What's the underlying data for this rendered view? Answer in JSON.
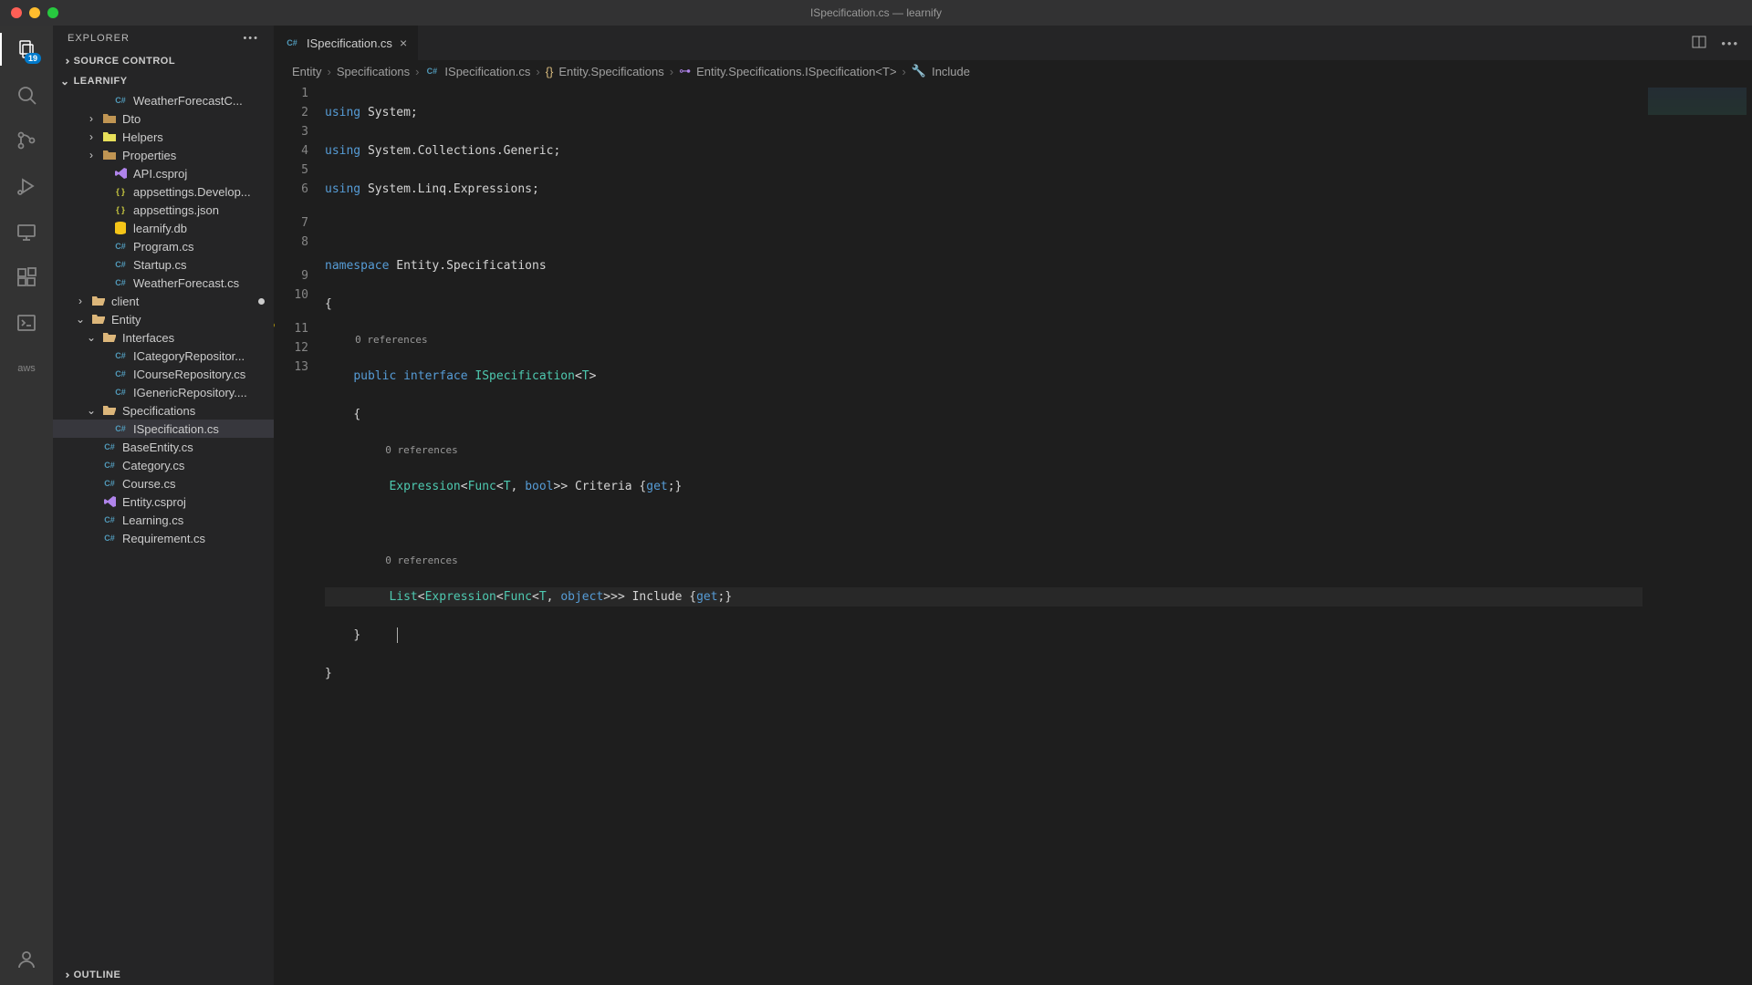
{
  "window": {
    "title": "ISpecification.cs — learnify"
  },
  "activityBar": {
    "badge": "19"
  },
  "sidebar": {
    "title": "EXPLORER",
    "sections": {
      "sourceControl": "SOURCE CONTROL",
      "project": "LEARNIFY",
      "outline": "OUTLINE"
    },
    "items": [
      {
        "label": "WeatherForecastC...",
        "icon": "cs",
        "indent": 4
      },
      {
        "label": "Dto",
        "icon": "folder",
        "twist": ">",
        "indent": 3
      },
      {
        "label": "Helpers",
        "icon": "folder-y",
        "twist": ">",
        "indent": 3
      },
      {
        "label": "Properties",
        "icon": "folder",
        "twist": ">",
        "indent": 3
      },
      {
        "label": "API.csproj",
        "icon": "vs",
        "indent": 4
      },
      {
        "label": "appsettings.Develop...",
        "icon": "json",
        "indent": 4
      },
      {
        "label": "appsettings.json",
        "icon": "json",
        "indent": 4
      },
      {
        "label": "learnify.db",
        "icon": "db",
        "indent": 4
      },
      {
        "label": "Program.cs",
        "icon": "cs",
        "indent": 4
      },
      {
        "label": "Startup.cs",
        "icon": "cs",
        "indent": 4
      },
      {
        "label": "WeatherForecast.cs",
        "icon": "cs",
        "indent": 4
      },
      {
        "label": "client",
        "icon": "folder-open",
        "twist": ">",
        "indent": 2,
        "dirty": true
      },
      {
        "label": "Entity",
        "icon": "folder-open",
        "twist": "v",
        "indent": 2
      },
      {
        "label": "Interfaces",
        "icon": "folder-open",
        "twist": "v",
        "indent": 3
      },
      {
        "label": "ICategoryRepositor...",
        "icon": "cs",
        "indent": 4
      },
      {
        "label": "ICourseRepository.cs",
        "icon": "cs",
        "indent": 4
      },
      {
        "label": "IGenericRepository....",
        "icon": "cs",
        "indent": 4
      },
      {
        "label": "Specifications",
        "icon": "folder-open",
        "twist": "v",
        "indent": 3
      },
      {
        "label": "ISpecification.cs",
        "icon": "cs",
        "indent": 4,
        "selected": true
      },
      {
        "label": "BaseEntity.cs",
        "icon": "cs",
        "indent": 3
      },
      {
        "label": "Category.cs",
        "icon": "cs",
        "indent": 3
      },
      {
        "label": "Course.cs",
        "icon": "cs",
        "indent": 3
      },
      {
        "label": "Entity.csproj",
        "icon": "vs",
        "indent": 3
      },
      {
        "label": "Learning.cs",
        "icon": "cs",
        "indent": 3
      },
      {
        "label": "Requirement.cs",
        "icon": "cs",
        "indent": 3
      }
    ]
  },
  "tab": {
    "label": "ISpecification.cs"
  },
  "breadcrumbs": [
    "Entity",
    "Specifications",
    "ISpecification.cs",
    "Entity.Specifications",
    "Entity.Specifications.ISpecification<T>",
    "Include"
  ],
  "codelens": {
    "zero": "0 references"
  },
  "code": {
    "l1a": "using",
    "l1b": " System;",
    "l2a": "using",
    "l2b": " System.Collections.Generic;",
    "l3a": "using",
    "l3b": " System.Linq.Expressions;",
    "l5a": "namespace",
    "l5b": " Entity.Specifications",
    "l6": "{",
    "l7a": "public",
    "l7b": "interface",
    "l7c": "ISpecification",
    "l7d": "T",
    "l8": "{",
    "l9a": "Expression",
    "l9b": "Func",
    "l9c": "T",
    "l9d": "bool",
    "l9e": " Criteria {",
    "l9f": "get",
    "l9g": ";}",
    "l11a": "List",
    "l11b": "Expression",
    "l11c": "Func",
    "l11d": "T",
    "l11e": "object",
    "l11f": " Include {",
    "l11g": "get",
    "l11h": ";}",
    "l12": "}",
    "l13": "}"
  },
  "lineNumbers": [
    "1",
    "2",
    "3",
    "4",
    "5",
    "6",
    "7",
    "8",
    "9",
    "10",
    "11",
    "12",
    "13"
  ]
}
